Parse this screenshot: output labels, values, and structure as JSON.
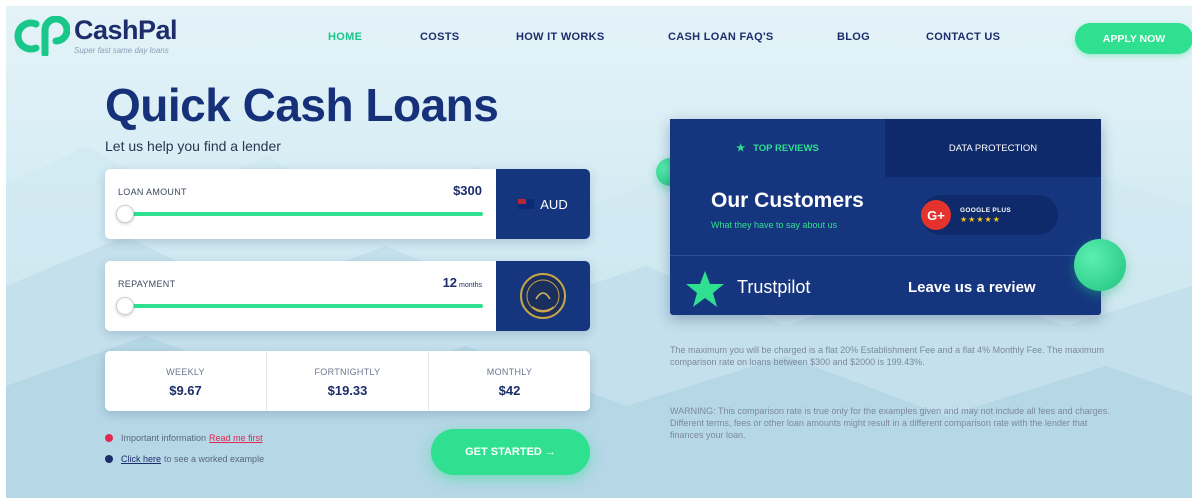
{
  "brand": {
    "name": "CashPal",
    "tagline": "Super fast same day loans",
    "accent": "#2ee08f",
    "primary": "#15367f"
  },
  "nav": {
    "items": [
      "HOME",
      "COSTS",
      "HOW IT WORKS",
      "CASH LOAN FAQ'S",
      "BLOG",
      "CONTACT US"
    ],
    "active": "HOME",
    "apply_label": "APPLY NOW"
  },
  "hero": {
    "title": "Quick Cash Loans",
    "subtitle": "Let us help you find a lender"
  },
  "loan_amount": {
    "label": "LOAN AMOUNT",
    "value": "$300",
    "currency": "AUD",
    "flag_icon": "australia-flag-icon",
    "slider_level": 0
  },
  "repayment": {
    "label": "REPAYMENT",
    "value": "12",
    "unit": "months",
    "badge_icon": "gold-seal-badge-icon",
    "slider_level": 0
  },
  "payments": [
    {
      "label": "WEEKLY",
      "value": "$9.67"
    },
    {
      "label": "FORTNIGHTLY",
      "value": "$19.33"
    },
    {
      "label": "MONTHLY",
      "value": "$42"
    }
  ],
  "info": {
    "important_text": "Important information",
    "important_link": "Read me first",
    "worked_link": "Click here",
    "worked_text": "to see a worked example"
  },
  "get_started_label": "GET STARTED →",
  "reviews": {
    "tab_top": "TOP REVIEWS",
    "tab_data": "DATA PROTECTION",
    "title": "Our Customers",
    "subtitle": "What they have to say about us",
    "gplus_label": "GOOGLE PLUS",
    "gplus_icon": "G+",
    "stars": "★★★★★",
    "trustpilot": "Trustpilot",
    "leave_review": "Leave us a review"
  },
  "fine_print": {
    "p1": "The maximum you will be charged is a flat 20% Establishment Fee and a flat 4% Monthly Fee. The maximum comparison rate on loans between $300 and $2000 is 199.43%.",
    "p2": "WARNING: This comparison rate is true only for the examples given and may not include all fees and charges. Different terms, fees or other loan amounts might result in a different comparison rate with the lender that finances your loan."
  }
}
